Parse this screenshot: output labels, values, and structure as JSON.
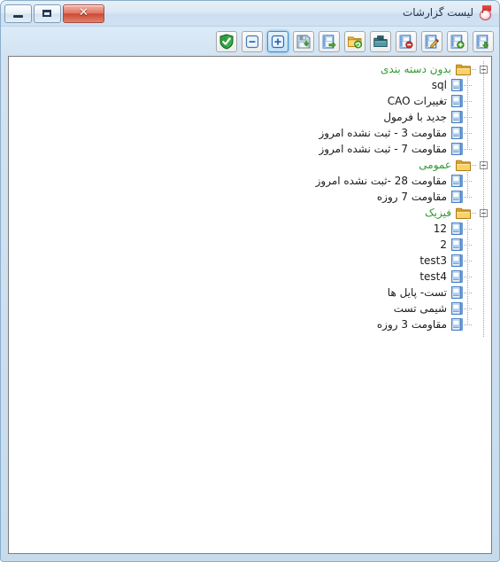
{
  "window": {
    "title": "لیست گزارشات",
    "icon": "report-stamp-icon",
    "controls": {
      "minimize_label": "–",
      "maximize_label": "▭",
      "close_label": "✕"
    }
  },
  "toolbar": {
    "buttons": [
      {
        "name": "approve-button",
        "icon": "green-shield-check-icon",
        "active": false
      },
      {
        "name": "collapse-all-button",
        "icon": "blue-minus-icon",
        "active": false
      },
      {
        "name": "expand-all-button",
        "icon": "blue-plus-icon",
        "active": true
      },
      {
        "name": "save-button",
        "icon": "floppy-disk-save-icon",
        "active": false
      },
      {
        "name": "export-report-button",
        "icon": "report-green-arrow-icon",
        "active": false
      },
      {
        "name": "refresh-folder-button",
        "icon": "folder-green-refresh-icon",
        "active": false
      },
      {
        "name": "archive-button",
        "icon": "teal-box-icon",
        "active": false
      },
      {
        "name": "delete-report-button",
        "icon": "report-red-minus-icon",
        "active": false
      },
      {
        "name": "edit-report-button",
        "icon": "report-pencil-edit-icon",
        "active": false
      },
      {
        "name": "add-report-button",
        "icon": "report-green-plus-icon",
        "active": false
      },
      {
        "name": "import-report-button",
        "icon": "report-green-down-arrow-icon",
        "active": false
      }
    ]
  },
  "tree": {
    "groups": [
      {
        "label": "بدون دسته بندی",
        "icon": "folder-icon",
        "expanded": true,
        "items": [
          {
            "label": "sql",
            "icon": "report-icon"
          },
          {
            "label": "تغییرات CAO",
            "icon": "report-icon"
          },
          {
            "label": "جدید با فرمول",
            "icon": "report-icon"
          },
          {
            "label": "مقاومت 3 - ثبت نشده امروز",
            "icon": "report-icon"
          },
          {
            "label": "مقاومت 7 - ثبت نشده امروز",
            "icon": "report-icon"
          }
        ]
      },
      {
        "label": "عمومی",
        "icon": "folder-icon",
        "expanded": true,
        "items": [
          {
            "label": "مقاومت 28 -ثبت نشده امروز",
            "icon": "report-icon"
          },
          {
            "label": "مقاومت 7 روزه",
            "icon": "report-icon"
          }
        ]
      },
      {
        "label": "فیزیک",
        "icon": "folder-icon",
        "expanded": true,
        "items": [
          {
            "label": "12",
            "icon": "report-icon"
          },
          {
            "label": "2",
            "icon": "report-icon"
          },
          {
            "label": "test3",
            "icon": "report-icon"
          },
          {
            "label": "test4",
            "icon": "report-icon"
          },
          {
            "label": "تست- پایل ها",
            "icon": "report-icon"
          },
          {
            "label": "شیمی تست",
            "icon": "report-icon"
          },
          {
            "label": "مقاومت 3 روزه",
            "icon": "report-icon"
          }
        ]
      }
    ]
  },
  "colors": {
    "group_text": "#2f9a2f",
    "item_text": "#1a1a1a",
    "window_chrome": "#cfe0f1",
    "close_button": "#cc4a34",
    "folder": "#f5c13d",
    "report_accent": "#3b78c3"
  }
}
